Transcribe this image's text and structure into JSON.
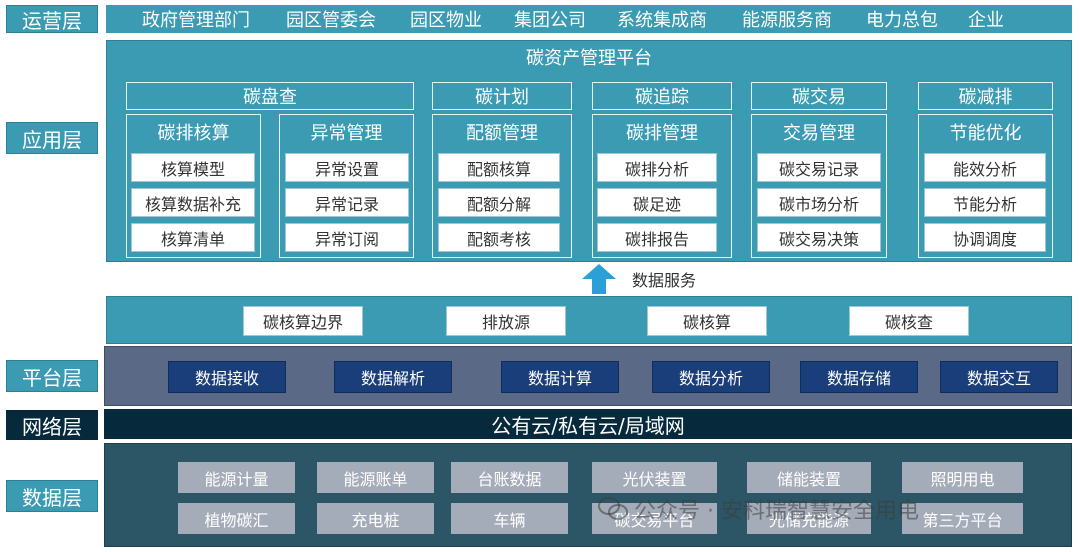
{
  "layers": {
    "ops": "运营层",
    "app": "应用层",
    "platform": "平台层",
    "network": "网络层",
    "data": "数据层"
  },
  "ops_items": [
    "政府管理部门",
    "园区管委会",
    "园区物业",
    "集团公司",
    "系统集成商",
    "能源服务商",
    "电力总包",
    "企业"
  ],
  "app_title": "碳资产管理平台",
  "categories": {
    "c1": "碳盘查",
    "c2": "碳计划",
    "c3": "碳追踪",
    "c4": "碳交易",
    "c5": "碳减排"
  },
  "groups": [
    {
      "title": "碳排核算",
      "items": [
        "核算模型",
        "核算数据补充",
        "核算清单"
      ]
    },
    {
      "title": "异常管理",
      "items": [
        "异常设置",
        "异常记录",
        "异常订阅"
      ]
    },
    {
      "title": "配额管理",
      "items": [
        "配额核算",
        "配额分解",
        "配额考核"
      ]
    },
    {
      "title": "碳排管理",
      "items": [
        "碳排分析",
        "碳足迹",
        "碳排报告"
      ]
    },
    {
      "title": "交易管理",
      "items": [
        "碳交易记录",
        "碳市场分析",
        "碳交易决策"
      ]
    },
    {
      "title": "节能优化",
      "items": [
        "能效分析",
        "节能分析",
        "协调调度"
      ]
    }
  ],
  "data_service": "数据服务",
  "carbon_items": [
    "碳核算边界",
    "排放源",
    "碳核算",
    "碳核查"
  ],
  "platform_items": [
    "数据接收",
    "数据解析",
    "数据计算",
    "数据分析",
    "数据存储",
    "数据交互"
  ],
  "network_text": "公有云/私有云/局域网",
  "data_items": [
    "能源计量",
    "能源账单",
    "台账数据",
    "光伏装置",
    "储能装置",
    "照明用电",
    "植物碳汇",
    "充电桩",
    "车辆",
    "碳交易平台",
    "光储充能源",
    "第三方平台"
  ],
  "watermark": "公众号 · 安科瑞智慧安全用电",
  "colors": {
    "teal": "#3a9bb3",
    "navy": "#1a3e7a",
    "network": "#062a3b",
    "data_bg": "#2c5566",
    "grey": "#a5acb9",
    "arrow": "#2aa0d8"
  }
}
